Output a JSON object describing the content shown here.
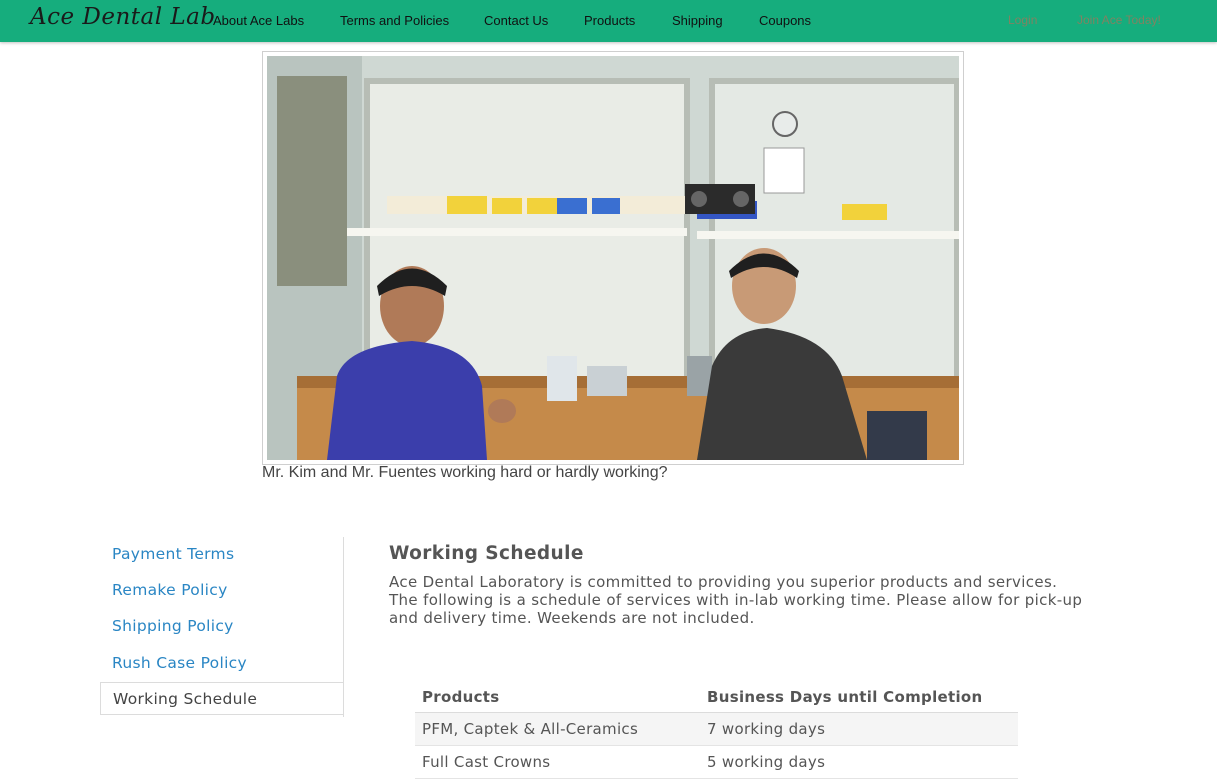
{
  "navbar": {
    "brand": "Ace Dental Lab",
    "links": [
      {
        "label": "About Ace Labs"
      },
      {
        "label": "Terms and Policies"
      },
      {
        "label": "Contact Us"
      },
      {
        "label": "Products"
      },
      {
        "label": "Shipping"
      },
      {
        "label": "Coupons"
      }
    ],
    "login_label": "Login",
    "join_label": "Join Ace Today!",
    "brand_color": "#16ad7d"
  },
  "photo": {
    "caption": "Mr. Kim and Mr. Fuentes working hard or hardly working?"
  },
  "sidebar": {
    "items": [
      {
        "label": "Payment Terms"
      },
      {
        "label": "Remake Policy"
      },
      {
        "label": "Shipping Policy"
      },
      {
        "label": "Rush Case Policy"
      },
      {
        "label": "Working Schedule"
      }
    ],
    "active_index": 4,
    "link_color": "#2a86c4"
  },
  "content": {
    "title": "Working Schedule",
    "description": "Ace Dental Laboratory is committed to providing you superior products and services. The following is a schedule of services with in-lab working time. Please allow for pick-up and delivery time. Weekends are not included."
  },
  "schedule_table": {
    "headers": [
      "Products",
      "Business Days until Completion"
    ],
    "rows": [
      [
        "PFM, Captek & All-Ceramics",
        "7 working days"
      ],
      [
        "Full Cast Crowns",
        "5 working days"
      ]
    ]
  }
}
